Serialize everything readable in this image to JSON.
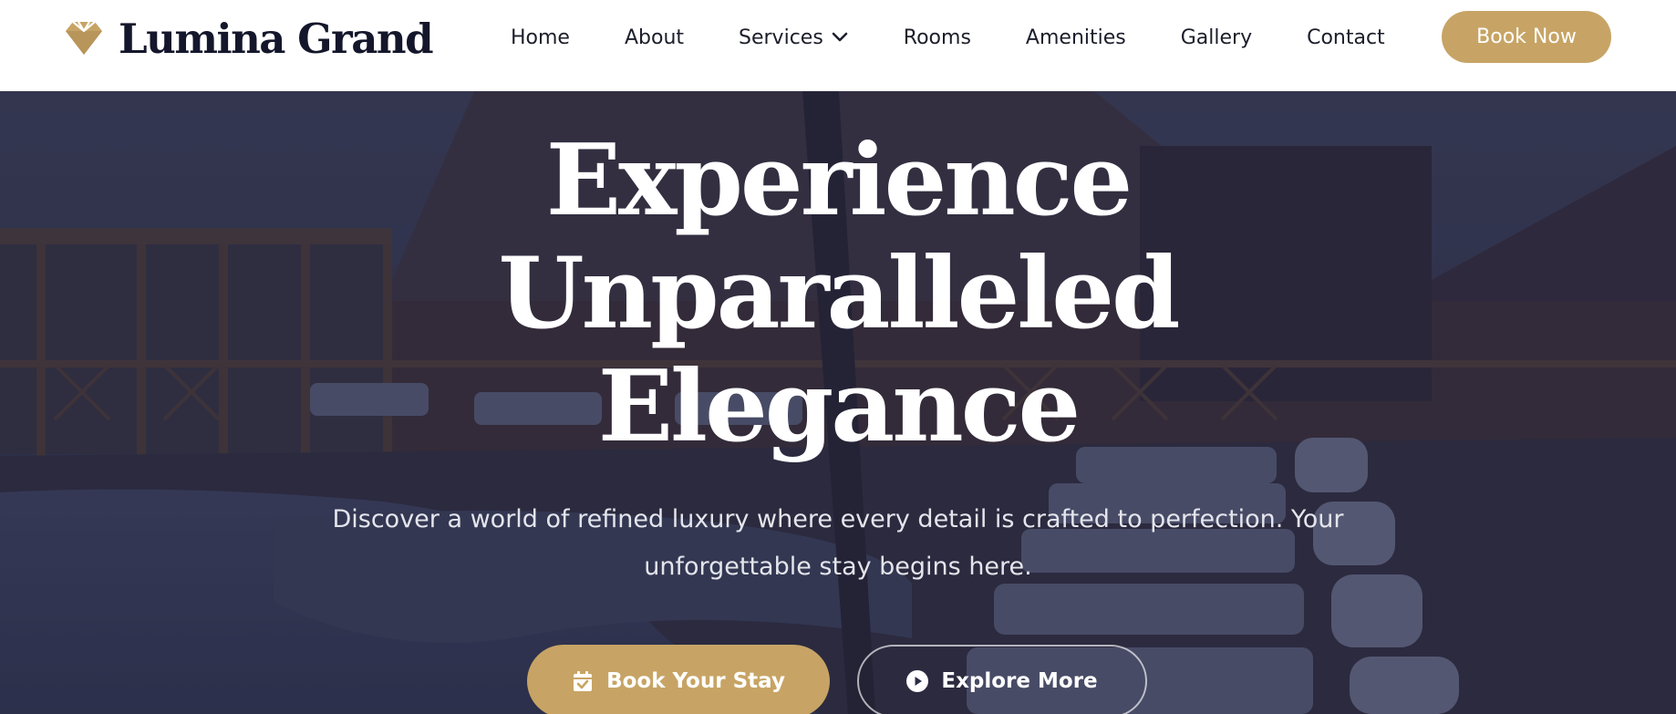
{
  "brand": {
    "name": "Lumina Grand",
    "icon": "diamond-icon",
    "accent_color": "#c7a465"
  },
  "nav": {
    "items": [
      {
        "label": "Home"
      },
      {
        "label": "About"
      },
      {
        "label": "Services",
        "has_dropdown": true,
        "icon": "chevron-down-icon"
      },
      {
        "label": "Rooms"
      },
      {
        "label": "Amenities"
      },
      {
        "label": "Gallery"
      },
      {
        "label": "Contact"
      }
    ],
    "cta_label": "Book Now"
  },
  "hero": {
    "title_lines": [
      "Experience",
      "Unparalleled",
      "Elegance"
    ],
    "subtitle": "Discover a world of refined luxury where every detail is crafted to perfection. Your unforgettable stay begins here.",
    "primary_button": {
      "label": "Book Your Stay",
      "icon": "calendar-check-icon"
    },
    "secondary_button": {
      "label": "Explore More",
      "icon": "play-circle-icon"
    },
    "overlay_color": "#272a44"
  }
}
